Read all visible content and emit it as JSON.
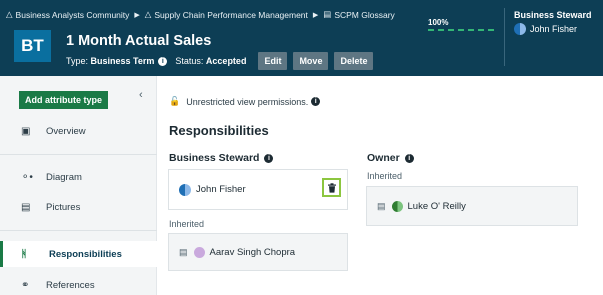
{
  "breadcrumb": {
    "items": [
      {
        "label": "Business Analysts Community"
      },
      {
        "label": "Supply Chain Performance Management"
      },
      {
        "label": "SCPM Glossary"
      }
    ]
  },
  "asset": {
    "initials": "BT",
    "title": "1 Month Actual Sales",
    "type_label": "Type:",
    "type_value": "Business Term",
    "status_label": "Status:",
    "status_value": "Accepted"
  },
  "toolbar": {
    "edit_label": "Edit",
    "move_label": "Move",
    "delete_label": "Delete"
  },
  "completeness": {
    "label": "100%",
    "value": 1.0
  },
  "header_steward": {
    "title": "Business Steward",
    "user": "John Fisher"
  },
  "sidebar": {
    "add_attribute_label": "Add attribute type",
    "items": [
      {
        "label": "Overview",
        "icon": "overview-icon"
      },
      {
        "label": "Diagram",
        "icon": "diagram-icon"
      },
      {
        "label": "Pictures",
        "icon": "pictures-icon"
      },
      {
        "label": "Responsibilities",
        "icon": "responsibilities-icon",
        "active": true
      },
      {
        "label": "References",
        "icon": "references-icon"
      }
    ]
  },
  "main": {
    "permissions_text": "Unrestricted view permissions.",
    "section_title": "Responsibilities",
    "business_steward": {
      "title": "Business Steward",
      "user": "John Fisher",
      "inherited_label": "Inherited",
      "inherited_user": "Aarav Singh Chopra"
    },
    "owner": {
      "title": "Owner",
      "inherited_label": "Inherited",
      "inherited_user": "Luke O' Reilly"
    }
  },
  "colors": {
    "header_bg": "#0d3e55",
    "accent_green": "#1a7a46",
    "highlight_green": "#8cc63f",
    "progress_green": "#33b676"
  }
}
